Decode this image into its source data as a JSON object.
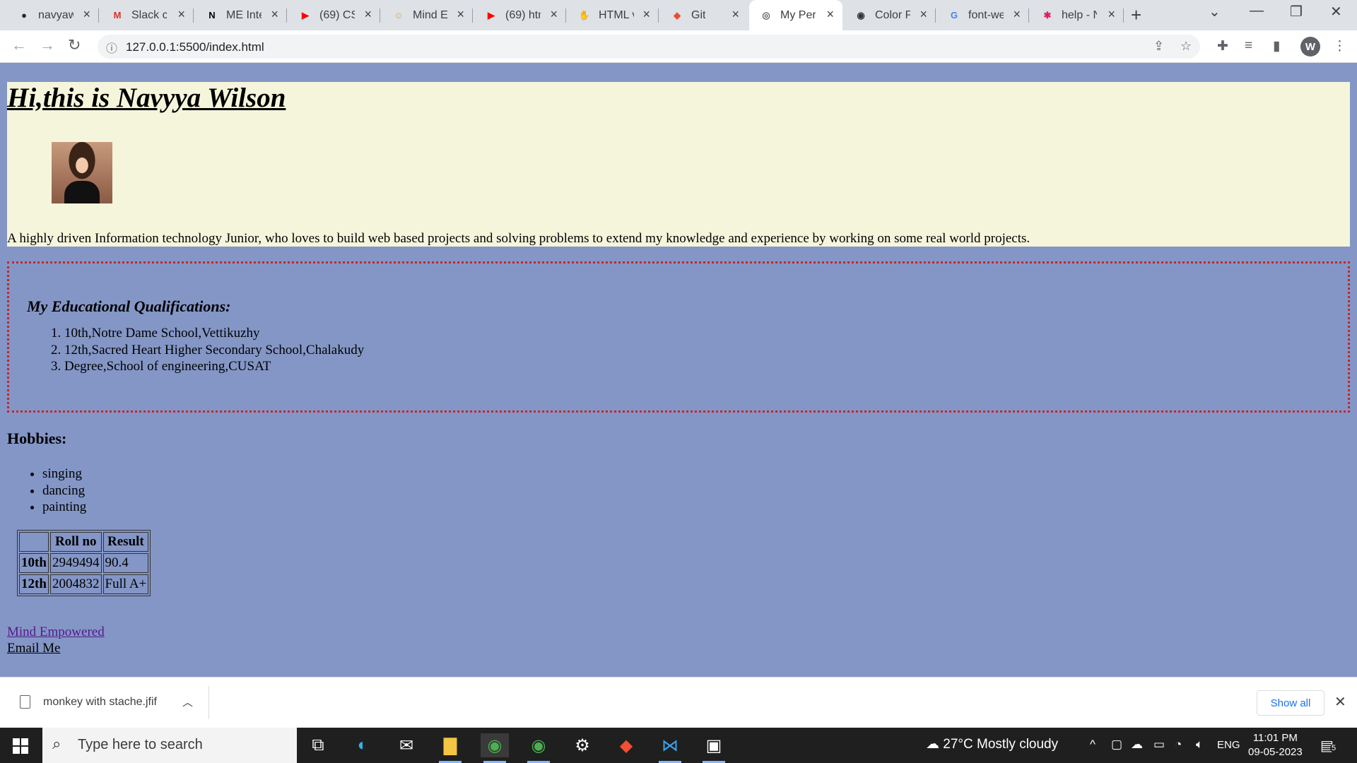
{
  "browser": {
    "tabs": [
      {
        "title": "navyaw",
        "icon": "github-icon",
        "icon_glyph": "●",
        "icon_color": "#24292f"
      },
      {
        "title": "Slack co",
        "icon": "gmail-icon",
        "icon_glyph": "M",
        "icon_color": "#d93025"
      },
      {
        "title": "ME Inte",
        "icon": "notion-icon",
        "icon_glyph": "N",
        "icon_color": "#000000"
      },
      {
        "title": "(69) CSS",
        "icon": "youtube-icon",
        "icon_glyph": "▶",
        "icon_color": "#ff0000"
      },
      {
        "title": "Mind Em",
        "icon": "mind-empowered-icon",
        "icon_glyph": "☺",
        "icon_color": "#e8a33d"
      },
      {
        "title": "(69) htm",
        "icon": "youtube-icon",
        "icon_glyph": "▶",
        "icon_color": "#ff0000"
      },
      {
        "title": "HTML v",
        "icon": "hand-icon",
        "icon_glyph": "✋",
        "icon_color": "#f4b400"
      },
      {
        "title": "Git",
        "icon": "git-icon",
        "icon_glyph": "◆",
        "icon_color": "#e94e31"
      },
      {
        "title": "My Pers",
        "icon": "globe-icon",
        "icon_glyph": "◎",
        "icon_color": "#5f6368",
        "active": true
      },
      {
        "title": "Color Pi",
        "icon": "color-picker-icon",
        "icon_glyph": "◉",
        "icon_color": "#333333"
      },
      {
        "title": "font-we",
        "icon": "google-icon",
        "icon_glyph": "G",
        "icon_color": "#4285f4"
      },
      {
        "title": "help - N",
        "icon": "slack-icon",
        "icon_glyph": "✱",
        "icon_color": "#e01e5a"
      }
    ],
    "url": "127.0.0.1:5500/index.html",
    "profile_initial": "W"
  },
  "page": {
    "heading": "Hi,this is Navyya Wilson",
    "bio": "A highly driven Information technology Junior, who loves to build web based projects and solving problems to extend my knowledge and experience by working on some real world projects.",
    "education": {
      "title": "My Educational Qualifications:",
      "items": [
        "10th,Notre Dame School,Vettikuzhy",
        "12th,Sacred Heart Higher Secondary School,Chalakudy",
        "Degree,School of engineering,CUSAT"
      ]
    },
    "hobbies": {
      "title": "Hobbies:",
      "items": [
        "singing",
        "dancing",
        "painting"
      ]
    },
    "results_table": {
      "headers": [
        "",
        "Roll no",
        "Result"
      ],
      "rows": [
        [
          "10th",
          "2949494",
          "90.4"
        ],
        [
          "12th",
          "2004832",
          "Full A+"
        ]
      ]
    },
    "links": {
      "mind": "Mind Empowered",
      "email": "Email Me"
    },
    "colors": {
      "page_bg": "#8496c6",
      "intro_bg": "#f5f5dc",
      "border": "#c3262d",
      "visited_link": "#551a8b"
    }
  },
  "downloads": {
    "file_name": "monkey with stache.jfif",
    "show_all": "Show all"
  },
  "taskbar": {
    "search_placeholder": "Type here to search",
    "weather_temp": "27°C",
    "weather_desc": "Mostly cloudy",
    "language": "ENG",
    "time": "11:01 PM",
    "date": "09-05-2023",
    "notification_count": "5"
  }
}
